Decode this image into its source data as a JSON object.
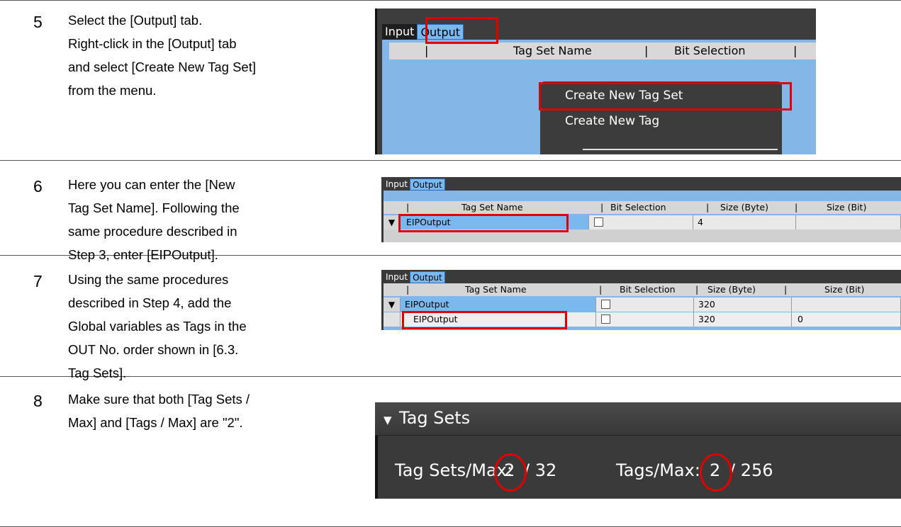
{
  "steps": [
    {
      "number": "5",
      "lines": [
        "Select the [Output] tab.",
        "Right-click in the [Output] tab",
        "and select [Create New Tag Set]",
        "from the menu."
      ]
    },
    {
      "number": "6",
      "lines": [
        "Here you can enter the [New",
        "Tag Set Name]. Following the",
        "same procedure described in",
        "Step 3, enter [EIPOutput]."
      ]
    },
    {
      "number": "7",
      "lines": [
        "Using the same procedures",
        "described in Step 4, add the",
        "Global variables as Tags in the",
        "OUT No. order shown in [6.3.",
        "Tag Sets]."
      ]
    },
    {
      "number": "8",
      "lines": [
        "Make sure that both [Tag Sets /",
        "Max] and [Tags / Max] are \"2\"."
      ]
    }
  ],
  "shot5": {
    "tab_input": "Input",
    "tab_output": "Output",
    "col_sep": "|",
    "col_tag_set_name": "Tag Set Name",
    "col_bit_selection": "Bit Selection",
    "menu_create_tag_set": "Create New Tag Set",
    "menu_create_tag": "Create New Tag"
  },
  "shot6": {
    "tab_input": "Input",
    "tab_output": "Output",
    "col_tag_set_name": "Tag Set Name",
    "col_bit_selection": "Bit Selection",
    "col_size_byte": "Size (Byte)",
    "col_size_bit": "Size (Bit)",
    "row_name": "EIPOutput",
    "row_size_byte": "4",
    "expand_glyph": "▼"
  },
  "shot7": {
    "tab_input": "Input",
    "tab_output": "Output",
    "col_tag_set_name": "Tag Set Name",
    "col_bit_selection": "Bit Selection",
    "col_size_byte": "Size (Byte)",
    "col_size_bit": "Size (Bit)",
    "set_row_name": "EIPOutput",
    "set_row_size_byte": "320",
    "tag_row_name": "EIPOutput",
    "tag_row_size_byte": "320",
    "tag_row_size_bit": "0",
    "expand_glyph": "▼"
  },
  "shot8": {
    "section_title": "Tag Sets",
    "expand_glyph": "▼",
    "tag_sets_label": "Tag Sets/Max:",
    "tag_sets_value": "2",
    "tag_sets_max": "/  32",
    "tags_label": "Tags/Max:",
    "tags_value": "2",
    "tags_max": "/  256"
  },
  "colors": {
    "highlight_red": "#e00000",
    "panel_blue": "#84b6e8",
    "selected_row_blue": "#7ab8f0",
    "dark_ui": "#3a3a3a"
  }
}
